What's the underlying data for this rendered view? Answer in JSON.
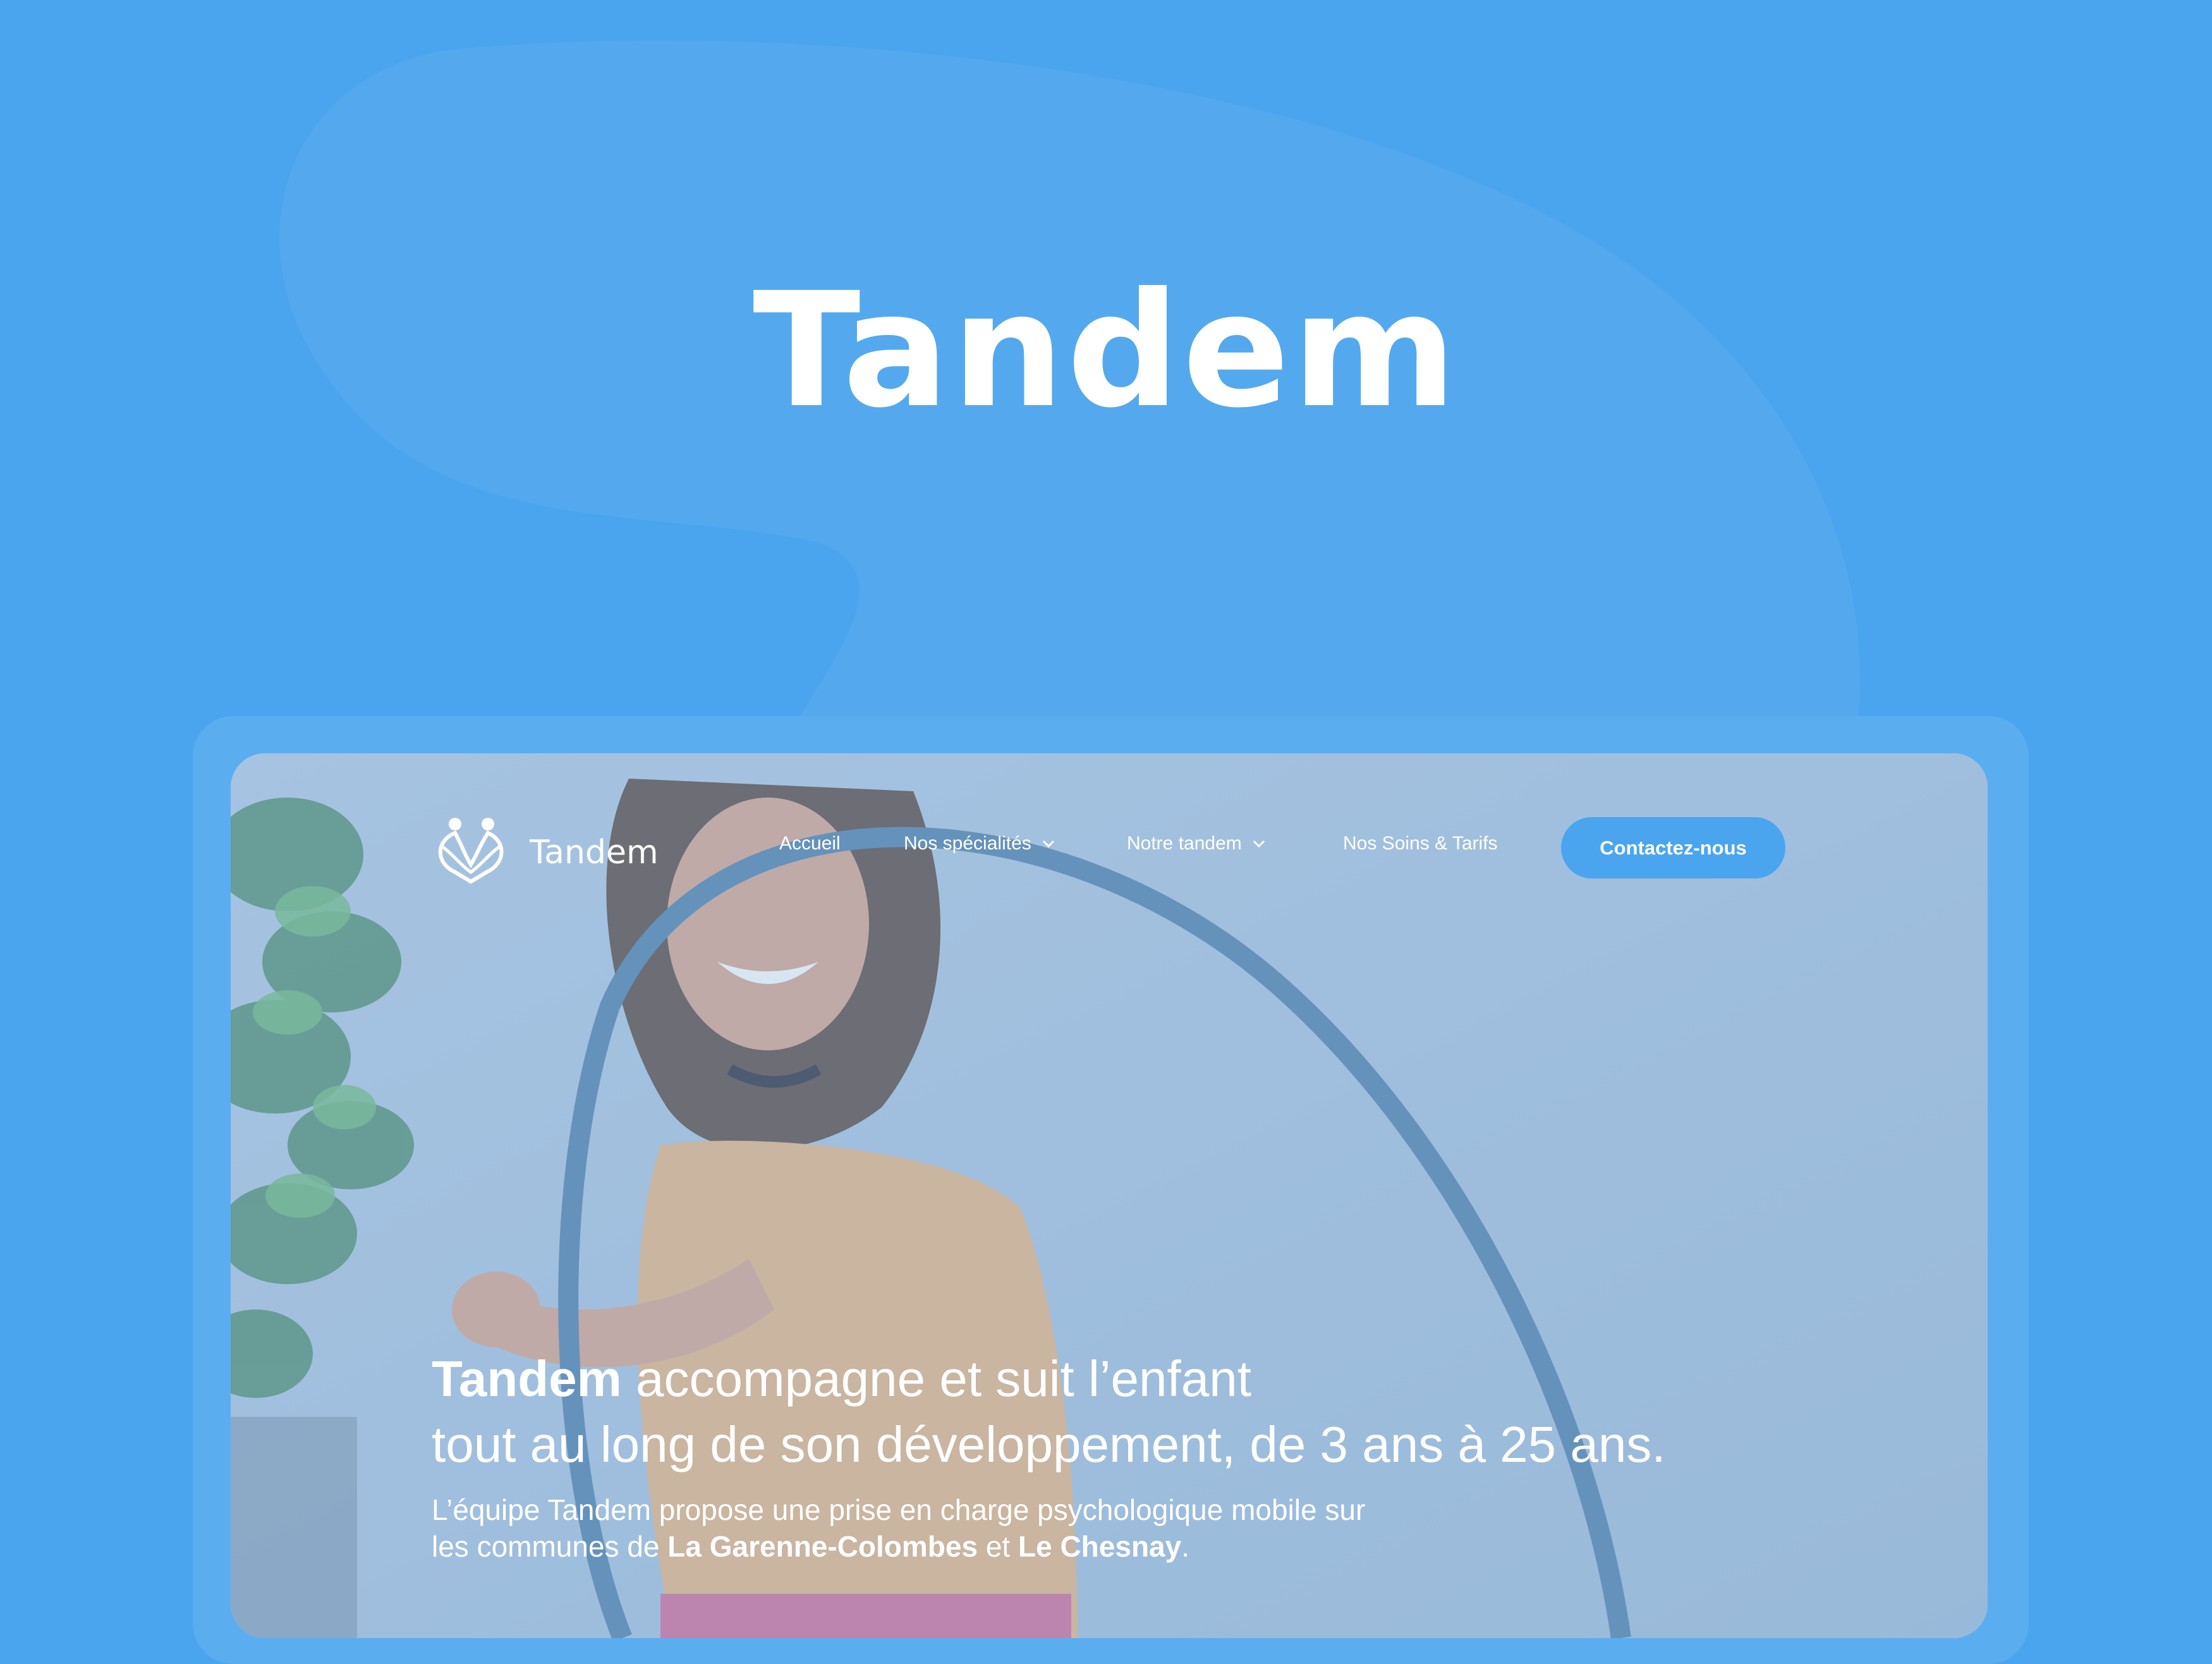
{
  "title": "Tandem",
  "colors": {
    "background": "#4aa5ee",
    "accent": "#4aa5ee",
    "text": "#ffffff"
  },
  "site": {
    "logo_text": "Tandem",
    "logo_icon": "people-heart-icon",
    "nav": {
      "home": "Accueil",
      "specialties": "Nos spécialités",
      "team": "Notre tandem",
      "care": "Nos Soins & Tarifs",
      "contact": "Contactez-nous"
    },
    "hero": {
      "brand": "Tandem",
      "line1_rest": " accompagne et suit l’enfant",
      "line2": "tout au long de son développement, de 3 ans à 25 ans.",
      "sub_part1": "L’équipe Tandem propose une prise en charge psychologique mobile sur",
      "sub_part2": "les communes de ",
      "town1": "La Garenne-Colombes",
      "sub_and": " et ",
      "town2": "Le Chesnay",
      "sub_end": "."
    }
  }
}
